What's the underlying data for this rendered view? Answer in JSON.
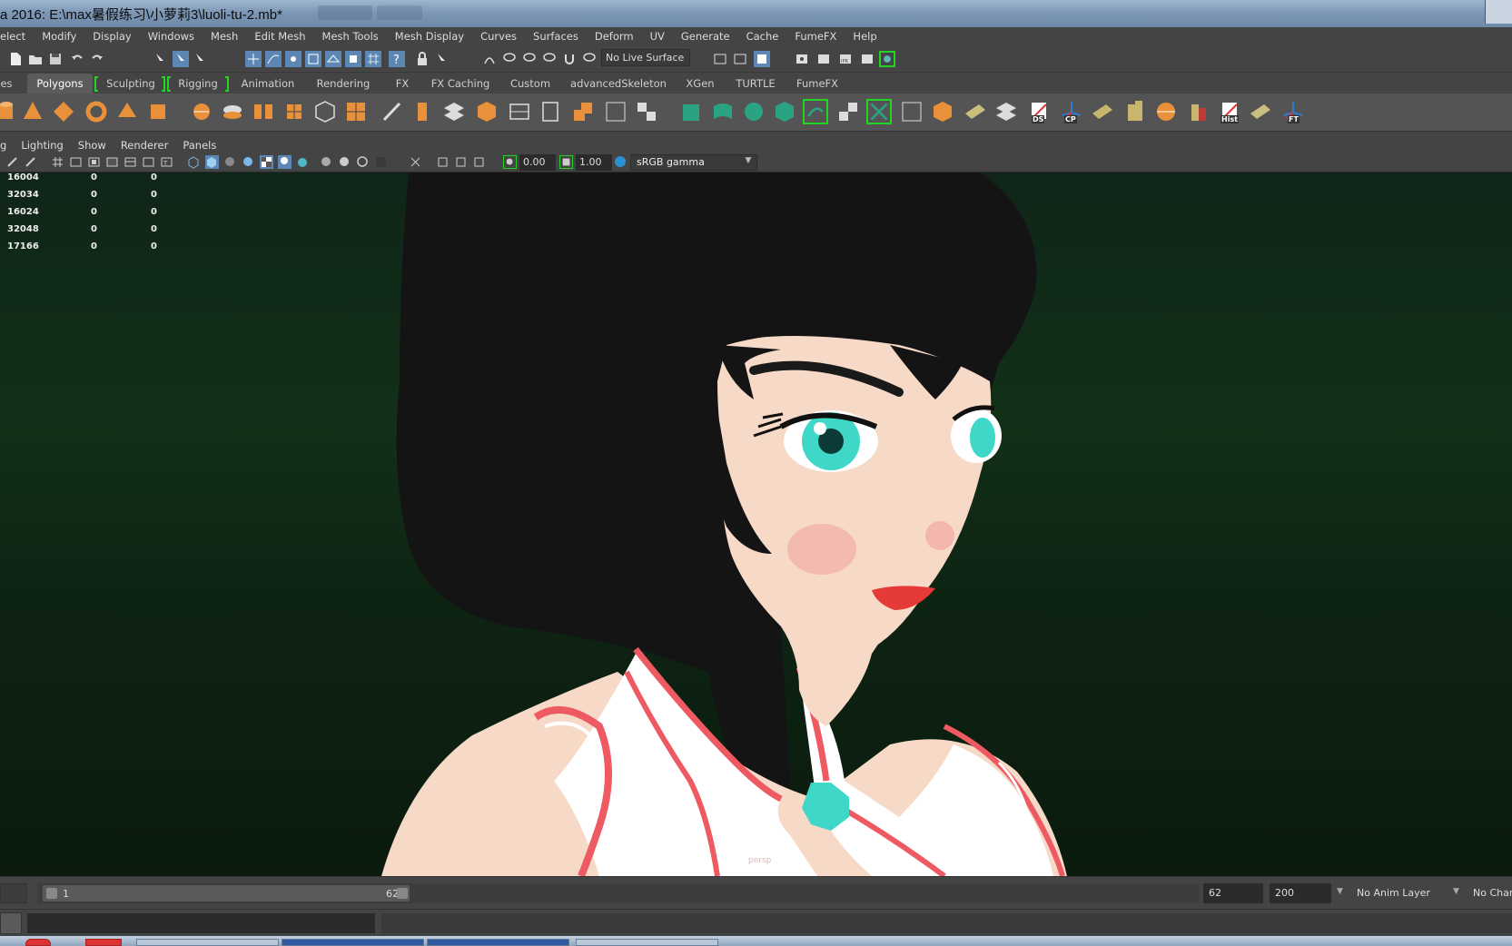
{
  "window": {
    "title": "a 2016: E:\\max暑假练习\\小萝莉3\\luoli-tu-2.mb*"
  },
  "menu": [
    "elect",
    "Modify",
    "Display",
    "Windows",
    "Mesh",
    "Edit Mesh",
    "Mesh Tools",
    "Mesh Display",
    "Curves",
    "Surfaces",
    "Deform",
    "UV",
    "Generate",
    "Cache",
    "FumeFX",
    "Help"
  ],
  "statusline": {
    "live_surface": "No Live Surface"
  },
  "shelf_tabs": {
    "partial": "es",
    "polygons": "Polygons",
    "sculpting": "Sculpting",
    "rigging": "Rigging",
    "animation": "Animation",
    "rendering": "Rendering",
    "fx": "FX",
    "fx_caching": "FX Caching",
    "custom": "Custom",
    "advanced_skeleton": "advancedSkeleton",
    "xgen": "XGen",
    "turtle": "TURTLE",
    "fumefx": "FumeFX"
  },
  "shelf_labels": {
    "ds": "DS",
    "cp": "CP",
    "hist": "Hist",
    "ft": "FT"
  },
  "panel_menu": {
    "partial": "g",
    "lighting": "Lighting",
    "show": "Show",
    "renderer": "Renderer",
    "panels": "Panels"
  },
  "panel_toolbar": {
    "exposure": "0.00",
    "gamma": "1.00",
    "color_space": "sRGB gamma"
  },
  "hud": {
    "rows": [
      {
        "a": "16004",
        "b": "0",
        "c": "0"
      },
      {
        "a": "32034",
        "b": "0",
        "c": "0"
      },
      {
        "a": "16024",
        "b": "0",
        "c": "0"
      },
      {
        "a": "32048",
        "b": "0",
        "c": "0"
      },
      {
        "a": "17166",
        "b": "0",
        "c": "0"
      }
    ]
  },
  "viewport": {
    "camera_label": "persp"
  },
  "timeslider": {
    "start": "1",
    "end": "62",
    "current": "62",
    "range_end": "200",
    "anim_layer": "No Anim Layer",
    "character": "No Char"
  },
  "colors": {
    "bg": "#444444",
    "shelf_bg": "#545454",
    "active_bracket": "#23d423",
    "viewport_top": "#123017",
    "skin": "#f7d9c7",
    "hair": "#141414",
    "eye": "#3fd8c8",
    "accent_red": "#ee5a62"
  }
}
